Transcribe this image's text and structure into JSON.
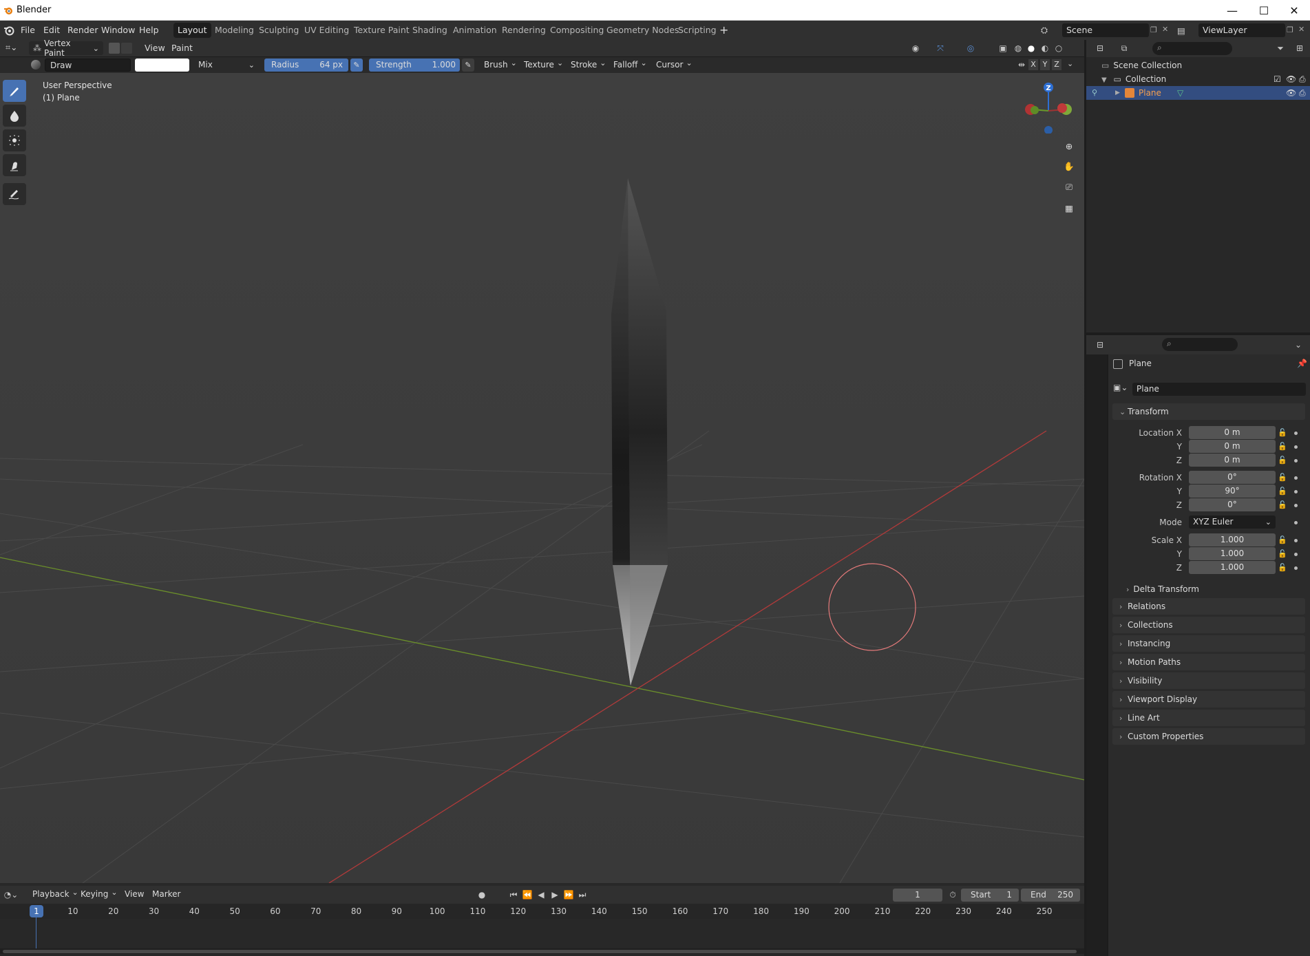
{
  "window": {
    "title": "Blender"
  },
  "menu": {
    "items": [
      "File",
      "Edit",
      "Render",
      "Window",
      "Help"
    ],
    "workspaces": [
      "Layout",
      "Modeling",
      "Sculpting",
      "UV Editing",
      "Texture Paint",
      "Shading",
      "Animation",
      "Rendering",
      "Compositing",
      "Geometry Nodes",
      "Scripting"
    ],
    "active_workspace": "Layout",
    "scene": "Scene",
    "view_layer": "ViewLayer"
  },
  "viewport_header": {
    "mode": "Vertex Paint",
    "view": "View",
    "paint": "Paint"
  },
  "tool_header": {
    "brush_name": "Draw",
    "blend": "Mix",
    "radius_label": "Radius",
    "radius_value": "64 px",
    "strength_label": "Strength",
    "strength_value": "1.000",
    "menus": [
      "Brush",
      "Texture",
      "Stroke",
      "Falloff",
      "Cursor"
    ],
    "axes": [
      "X",
      "Y",
      "Z"
    ]
  },
  "viewport": {
    "overlay_line1": "User Perspective",
    "overlay_line2": "(1) Plane",
    "gizmo_z": "Z"
  },
  "outliner": {
    "scene_collection": "Scene Collection",
    "collection": "Collection",
    "object": "Plane"
  },
  "properties": {
    "object_name": "Plane",
    "data_name": "Plane",
    "transform": {
      "title": "Transform",
      "location_label": "Location X",
      "location": [
        "0 m",
        "0 m",
        "0 m"
      ],
      "rotation_label": "Rotation X",
      "rotation": [
        "0°",
        "90°",
        "0°"
      ],
      "mode_label": "Mode",
      "mode": "XYZ Euler",
      "scale_label": "Scale X",
      "scale": [
        "1.000",
        "1.000",
        "1.000"
      ],
      "axis_y": "Y",
      "axis_z": "Z",
      "delta": "Delta Transform"
    },
    "panels": [
      "Relations",
      "Collections",
      "Instancing",
      "Motion Paths",
      "Visibility",
      "Viewport Display",
      "Line Art",
      "Custom Properties"
    ]
  },
  "timeline": {
    "menus": [
      "Playback",
      "Keying",
      "View",
      "Marker"
    ],
    "current_frame": "1",
    "start_label": "Start",
    "start": "1",
    "end_label": "End",
    "end": "250",
    "ruler": [
      "1",
      "10",
      "20",
      "30",
      "40",
      "50",
      "60",
      "70",
      "80",
      "90",
      "100",
      "110",
      "120",
      "130",
      "140",
      "150",
      "160",
      "170",
      "180",
      "190",
      "200",
      "210",
      "220",
      "230",
      "240",
      "250"
    ]
  }
}
